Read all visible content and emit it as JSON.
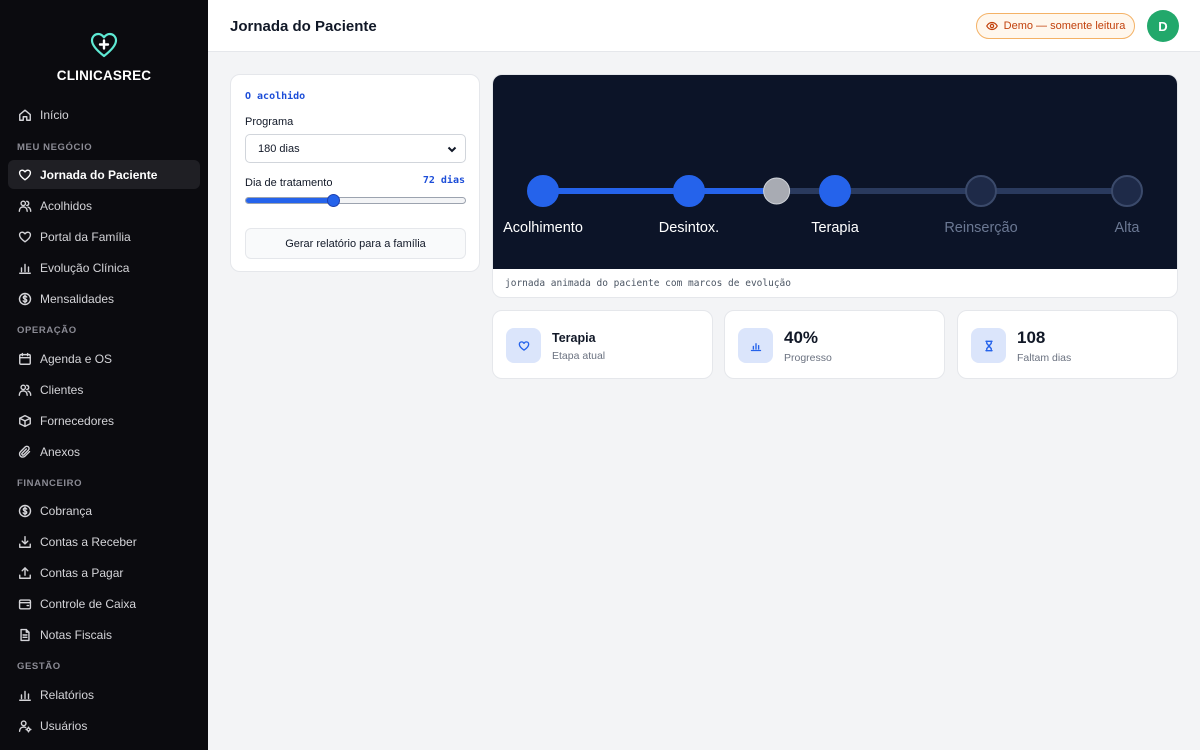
{
  "app": {
    "name": "CLINICASREC"
  },
  "sidebar": {
    "items": [
      {
        "label": "Início",
        "icon": "home-icon"
      },
      {
        "label": "Jornada do Paciente",
        "icon": "heart-icon",
        "active": true
      },
      {
        "label": "Acolhidos",
        "icon": "users-icon"
      },
      {
        "label": "Portal da Família",
        "icon": "heart-icon"
      },
      {
        "label": "Evolução Clínica",
        "icon": "bar-chart-icon"
      },
      {
        "label": "Mensalidades",
        "icon": "dollar-circle-icon"
      },
      {
        "label": "Agenda e OS",
        "icon": "calendar-icon"
      },
      {
        "label": "Clientes",
        "icon": "users-icon"
      },
      {
        "label": "Fornecedores",
        "icon": "box-icon"
      },
      {
        "label": "Anexos",
        "icon": "paperclip-icon"
      },
      {
        "label": "Cobrança",
        "icon": "dollar-circle-icon"
      },
      {
        "label": "Contas a Receber",
        "icon": "download-icon"
      },
      {
        "label": "Contas a Pagar",
        "icon": "upload-icon"
      },
      {
        "label": "Controle de Caixa",
        "icon": "wallet-icon"
      },
      {
        "label": "Notas Fiscais",
        "icon": "document-icon"
      },
      {
        "label": "Relatórios",
        "icon": "bar-chart-icon"
      },
      {
        "label": "Usuários",
        "icon": "user-gear-icon"
      }
    ],
    "sections": [
      "MEU NEGÓCIO",
      "OPERAÇÃO",
      "FINANCEIRO",
      "GESTÃO"
    ]
  },
  "header": {
    "title": "Jornada do Paciente",
    "badge": "Demo — somente leitura",
    "avatar_initial": "D"
  },
  "controls": {
    "patient_name": "O acolhido",
    "program_label": "Programa",
    "program_value": "180 dias",
    "day_label": "Dia de tratamento",
    "day_value": "72 dias",
    "day_fraction": 0.4,
    "report_button": "Gerar relatório para a família"
  },
  "journey": {
    "stages": [
      "Acolhimento",
      "Desintox.",
      "Terapia",
      "Reinserção",
      "Alta"
    ],
    "current_stage_index": 2,
    "progress_fraction": 0.4,
    "caption": "jornada animada do paciente com marcos de evolução"
  },
  "stats": [
    {
      "value": "Terapia",
      "label": "Etapa atual",
      "icon": "heart-icon"
    },
    {
      "value": "40%",
      "label": "Progresso",
      "icon": "bar-chart-icon"
    },
    {
      "value": "108",
      "label": "Faltam dias",
      "icon": "hourglass-icon"
    }
  ],
  "colors": {
    "accent": "#2563eb",
    "sidebar_bg": "#0b0b0f",
    "active_indicator": "#22c55e",
    "journey_bg": "#0c1428",
    "badge": "#c2410c",
    "avatar": "#22a86b"
  }
}
